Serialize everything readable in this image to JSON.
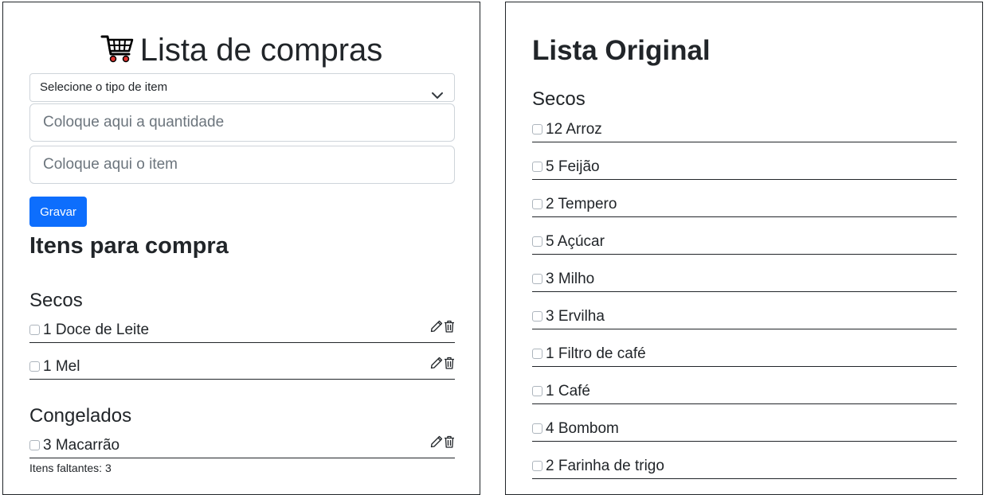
{
  "left": {
    "title": "Lista de compras",
    "cart_icon": "shopping-cart-icon",
    "select": {
      "value": "Selecione o tipo de item"
    },
    "quantity_input": {
      "placeholder": "Coloque aqui a quantidade",
      "value": ""
    },
    "item_input": {
      "placeholder": "Coloque aqui o item",
      "value": ""
    },
    "save_label": "Gravar",
    "items_heading": "Itens para compra",
    "categories": [
      {
        "name": "Secos",
        "items": [
          "1 Doce de Leite",
          "1 Mel"
        ]
      },
      {
        "name": "Congelados",
        "items": [
          "3 Macarrão"
        ]
      }
    ],
    "footer": "Itens faltantes: 3"
  },
  "right": {
    "title": "Lista Original",
    "category": "Secos",
    "items": [
      "12 Arroz",
      "5 Feijão",
      "2 Tempero",
      "5 Açúcar",
      "3 Milho",
      "3 Ervilha",
      "1 Filtro de café",
      "1 Café",
      "4 Bombom",
      "2 Farinha de trigo"
    ]
  },
  "colors": {
    "primary": "#0d6efd",
    "text": "#212529",
    "placeholder": "#6c757d",
    "border": "#ced4da"
  }
}
